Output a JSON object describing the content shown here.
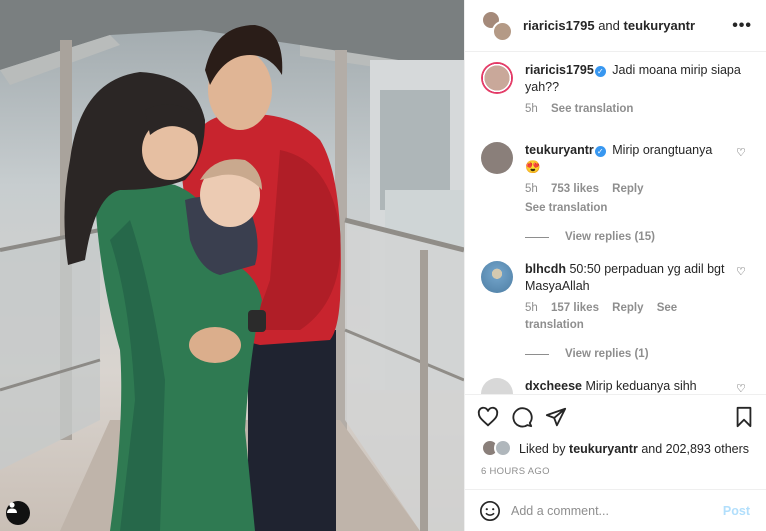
{
  "header": {
    "user1": "riaricis1795",
    "joiner": "and",
    "user2": "teukuryantr",
    "more_icon": "more-horizontal-icon"
  },
  "comments": [
    {
      "user": "riaricis1795",
      "verified": true,
      "text": "Jadi moana mirip siapa yah??",
      "time": "5h",
      "translate": "See translation",
      "avatar_color": "#c9a89a"
    },
    {
      "user": "teukuryantr",
      "verified": true,
      "text": "Mirip orangtuanya",
      "emoji": "😍",
      "time": "5h",
      "likes": "753 likes",
      "reply": "Reply",
      "translate": "See translation",
      "view_replies": "View replies (15)",
      "avatar_color": "#8a7f7a"
    },
    {
      "user": "blhcdh",
      "verified": false,
      "text": "50:50 perpaduan yg adil bgt MasyaAllah",
      "time": "5h",
      "likes": "157 likes",
      "reply": "Reply",
      "translate": "See translation",
      "view_replies": "View replies (1)",
      "avatar_color": "#6d9ec4"
    },
    {
      "user": "dxcheese",
      "verified": false,
      "text": "Mirip keduanya sihh",
      "avatar_color": "#d8d8d8"
    }
  ],
  "likes": {
    "prefix": "Liked by",
    "user": "teukuryantr",
    "rest": "and 202,893 others"
  },
  "time_ago": "6 HOURS AGO",
  "add_comment": {
    "placeholder": "Add a comment...",
    "post_label": "Post"
  }
}
